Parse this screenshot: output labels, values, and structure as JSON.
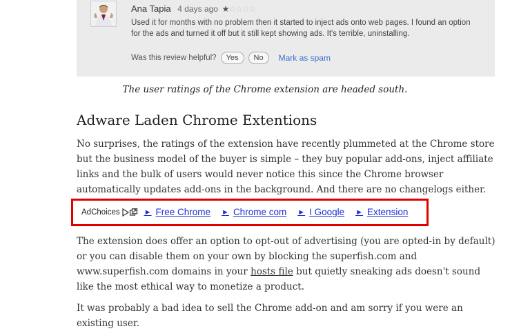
{
  "review": {
    "author": "Ana Tapia",
    "date": "4 days ago",
    "rating": 1,
    "rating_max": 5,
    "star_filled": "★",
    "star_empty": "☆☆☆☆",
    "text": "Used it for months with no problem then it started to inject ads onto web pages. I found an option for the ads and turned it off but it still kept showing ads. It's terrible, uninstalling.",
    "helpful_question": "Was this review helpful?",
    "yes_label": "Yes",
    "no_label": "No",
    "spam_label": "Mark as spam"
  },
  "article": {
    "caption": "The user ratings of the Chrome extension are headed south.",
    "heading": "Adware Laden Chrome Extentions",
    "para1": "No surprises, the ratings of the extension have recently plummeted at the Chrome store but the business model of the buyer is simple – they buy popular add-ons, inject affiliate links and the bulk of users would never notice this since the Chrome browser automatically updates add-ons in the background. And there are no changelogs either.",
    "para2_before": "The extension does offer an option to opt-out of advertising (you are opted-in by default) or you can disable them on your own by blocking the superfish.com and www.superfish.com domains in your ",
    "para2_link": "hosts file",
    "para2_after": " but quietly sneaking ads doesn't sound like the most ethical way to monetize a product.",
    "para3": "It was probably a bad idea to sell the Chrome add-on and am sorry if you were an existing user."
  },
  "ads": {
    "adchoices_label": "AdChoices",
    "arrow_glyph": "►",
    "links": [
      "Free Chrome",
      "Chrome com",
      "I Google",
      "Extension"
    ],
    "link_color": "#1f30d6",
    "highlight_color": "#e00000"
  }
}
